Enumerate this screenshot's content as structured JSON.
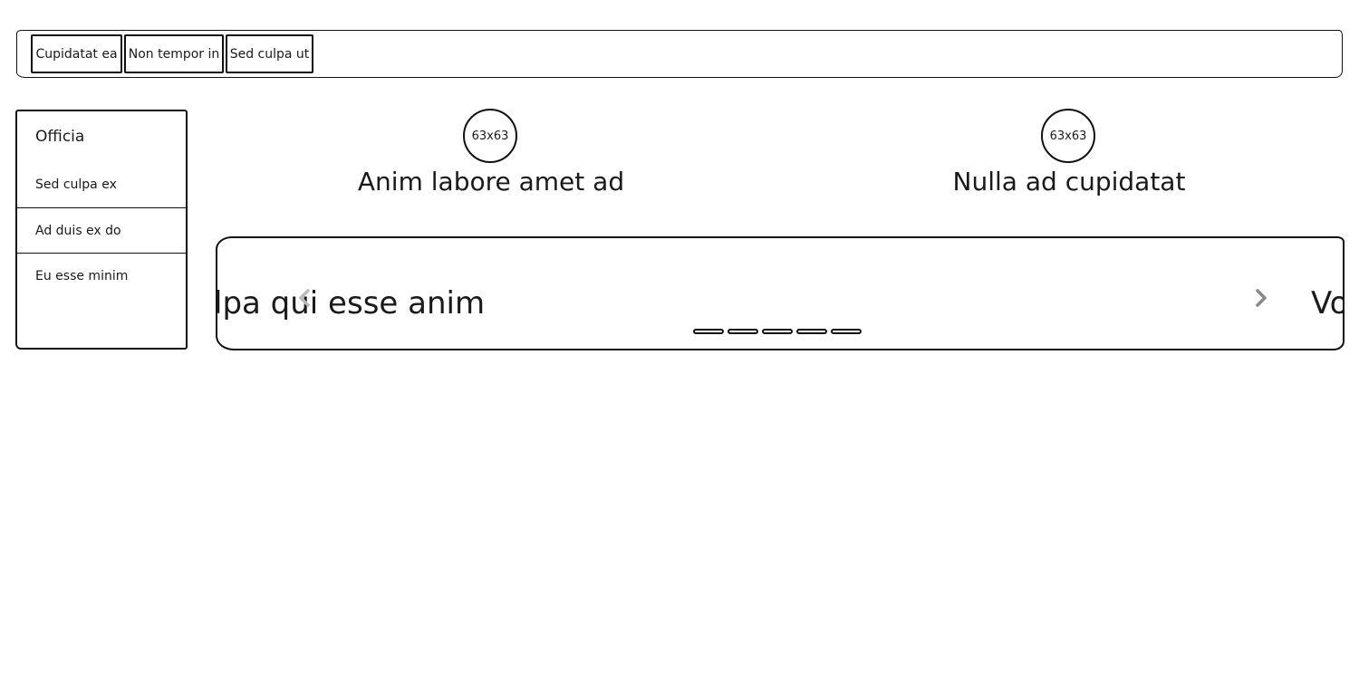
{
  "tabs": [
    {
      "label": "Cupidatat ea"
    },
    {
      "label": "Non tempor in"
    },
    {
      "label": "Sed culpa ut"
    }
  ],
  "sidebar": {
    "title": "Officia",
    "items": [
      {
        "label": "Sed culpa ex"
      },
      {
        "label": "Ad duis ex do"
      },
      {
        "label": "Eu esse minim"
      }
    ]
  },
  "features": [
    {
      "image_label": "63x63",
      "caption": "Anim labore amet ad"
    },
    {
      "image_label": "63x63",
      "caption": "Nulla ad cupidatat"
    }
  ],
  "carousel": {
    "current_text": "lpa qui esse anim",
    "next_text": "Vo",
    "prev_icon": "chevron-left-icon",
    "next_icon": "chevron-right-icon",
    "indicator_count": 5
  }
}
